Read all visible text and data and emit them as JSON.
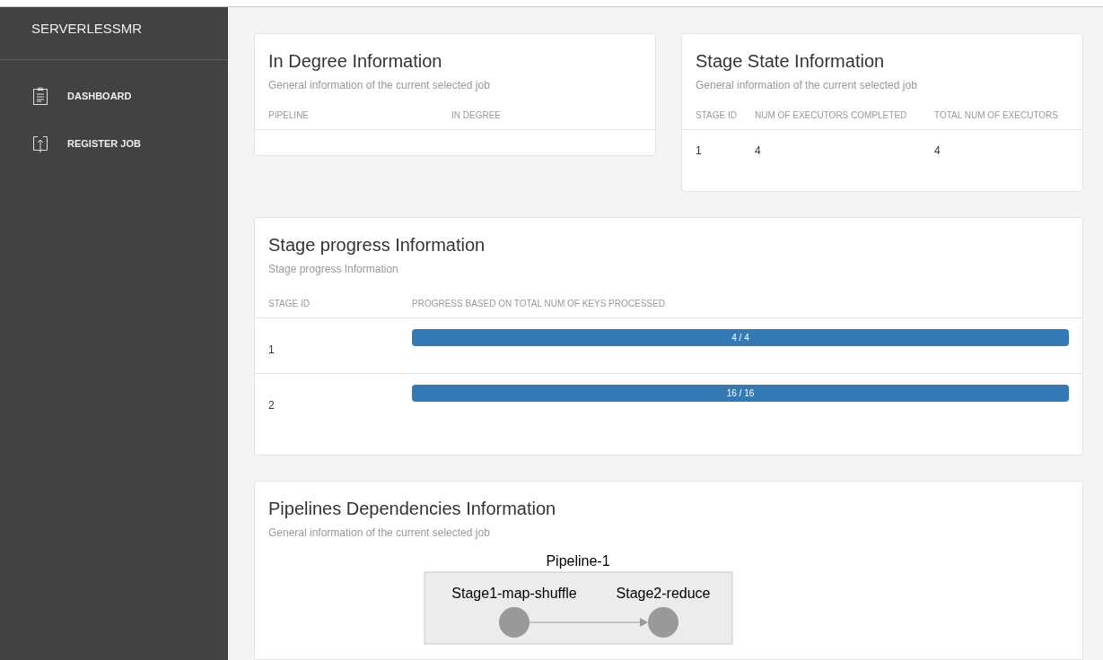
{
  "sidebar": {
    "title": "SERVERLESSMR",
    "items": [
      {
        "label": "DASHBOARD",
        "selected": false
      },
      {
        "label": "REGISTER JOB",
        "selected": false
      }
    ]
  },
  "in_degree": {
    "title": "In Degree Information",
    "subtitle": "General information of the current selected job",
    "columns": [
      "PIPELINE",
      "IN DEGREE"
    ]
  },
  "stage_state": {
    "title": "Stage State Information",
    "subtitle": "General information of the current selected job",
    "columns": [
      "STAGE ID",
      "NUM OF EXECUTORS COMPLETED",
      "TOTAL NUM OF EXECUTORS"
    ],
    "rows": [
      [
        "1",
        "4",
        "4"
      ]
    ]
  },
  "stage_progress": {
    "title": "Stage progress Information",
    "subtitle": "Stage progress Information",
    "columns": [
      "STAGE ID",
      "PROGRESS BASED ON TOTAL NUM OF KEYS PROCESSED"
    ],
    "rows": [
      {
        "stage": "1",
        "reading": "4 / 4",
        "level": 1
      },
      {
        "stage": "2",
        "reading": "16 / 16",
        "level": 1
      }
    ]
  },
  "dependencies": {
    "title": "Pipelines Dependencies Information",
    "subtitle": "General information of the current selected job",
    "pipeline": {
      "label": "Pipeline-1",
      "stages": [
        "Stage1-map-shuffle",
        "Stage2-reduce"
      ]
    }
  }
}
